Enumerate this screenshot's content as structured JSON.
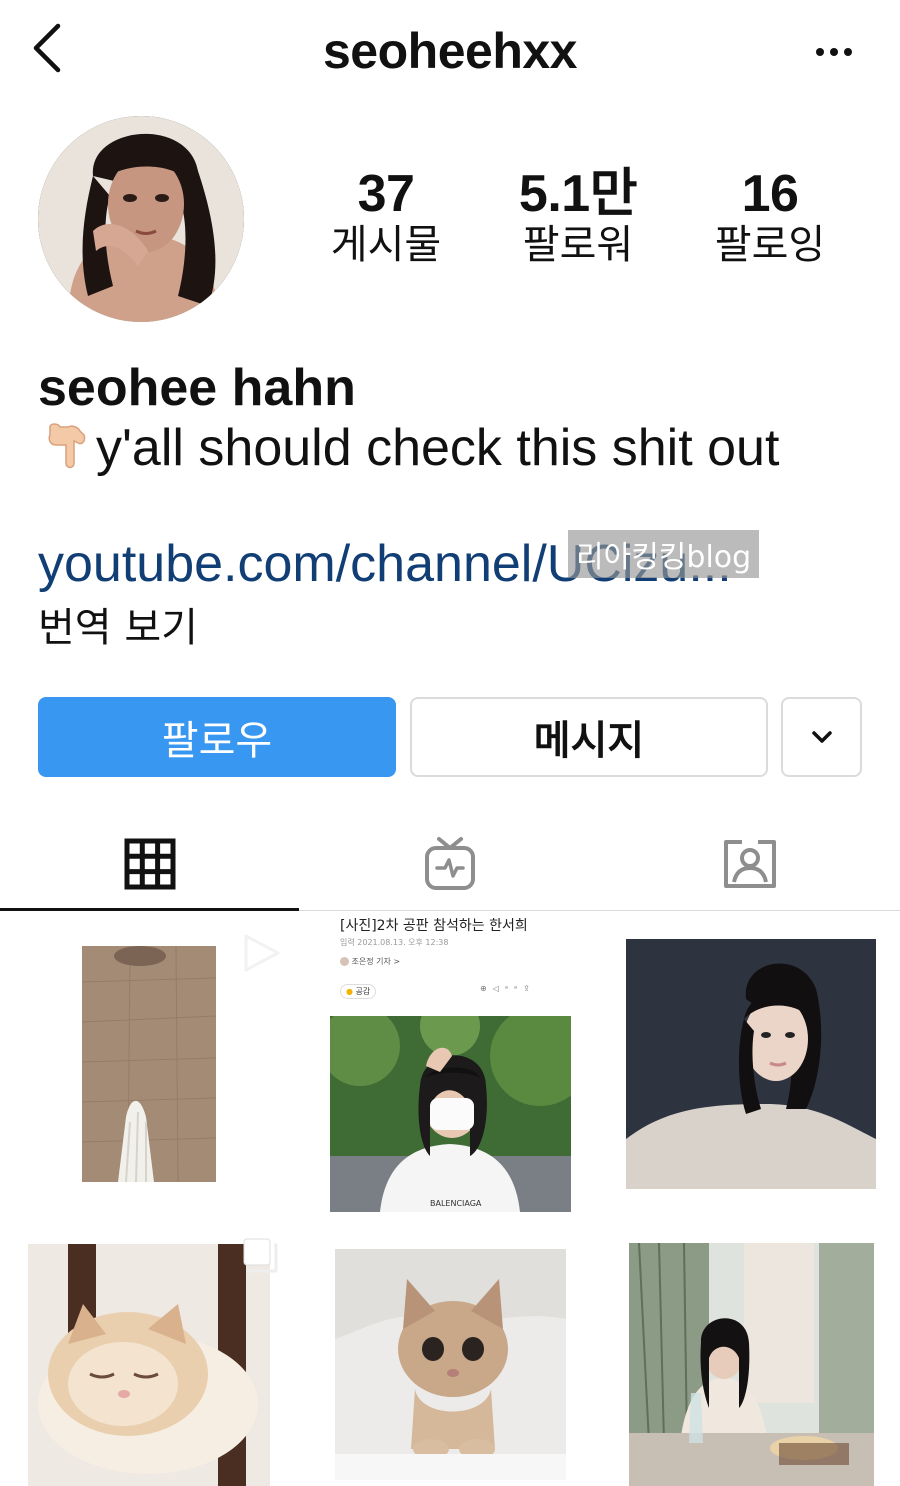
{
  "header": {
    "username": "seoheehxx",
    "back_icon": "chevron-left-icon",
    "more_icon": "more-horizontal-icon"
  },
  "profile": {
    "stats": [
      {
        "value": "37",
        "label": "게시물"
      },
      {
        "value": "5.1만",
        "label": "팔로워"
      },
      {
        "value": "16",
        "label": "팔로잉"
      }
    ],
    "full_name": "seohee hahn",
    "bio": "y'all should check this shit out",
    "bio_emoji": "hand-pointing-down-icon",
    "link": "youtube.com/channel/UCizu...",
    "watermark": "리아킹킹blog",
    "translate": "번역 보기"
  },
  "actions": {
    "follow": "팔로우",
    "message": "메시지",
    "dropdown_icon": "chevron-down-icon"
  },
  "tabs": [
    {
      "name": "grid",
      "icon": "grid-icon",
      "active": true
    },
    {
      "name": "igtv",
      "icon": "igtv-icon",
      "active": false
    },
    {
      "name": "tagged",
      "icon": "tagged-person-icon",
      "active": false
    }
  ],
  "posts": {
    "news_title": "[사진]2차 공판 참석하는 한서희",
    "news_meta": "입력 2021.08.13. 오후 12:38",
    "news_reporter": "조은정 기자 >",
    "news_badge": "공감",
    "news_tshirt": "BALENCIAGA",
    "badges": {
      "reel": "reel-icon",
      "multi": "multiple-photos-icon"
    }
  },
  "colors": {
    "accent": "#3897f0",
    "link": "#113f75",
    "border": "#dbdbdb"
  }
}
